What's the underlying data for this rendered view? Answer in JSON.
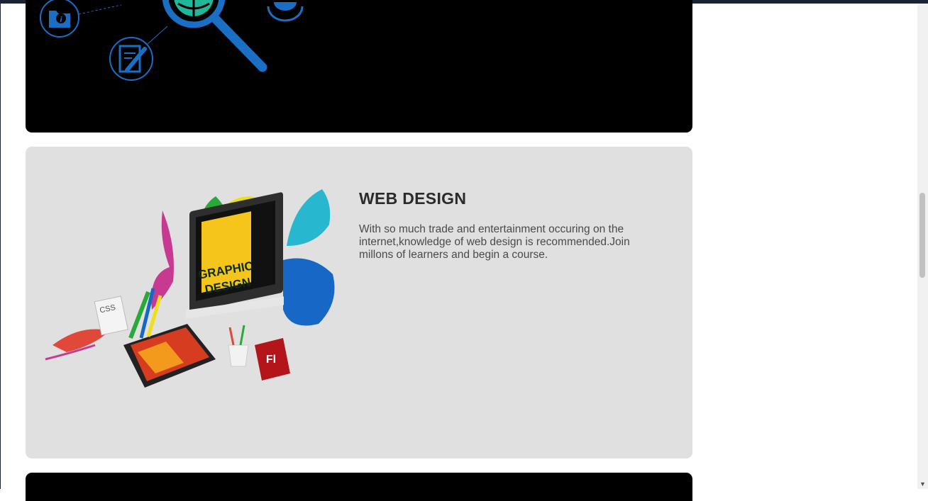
{
  "course": {
    "title": "WEB DESIGN",
    "description": "With so much trade and entertainment occuring on the internet,knowledge of web design is recommended.Join millons of learners and begin a course."
  },
  "illustration": {
    "screen_text_line1": "GRAPHIC",
    "screen_text_line2": "DESIGN",
    "css_label": "CSS",
    "flash_label": "Fl"
  },
  "icons": [
    "info-folder-icon",
    "magnifier-globe-icon",
    "document-edit-icon",
    "chevron-down-icon"
  ],
  "colors": {
    "dark_card": "#000000",
    "light_card": "#e0e0e0",
    "icon_blue": "#1a6fc4",
    "globe_teal": "#1fb89a"
  }
}
